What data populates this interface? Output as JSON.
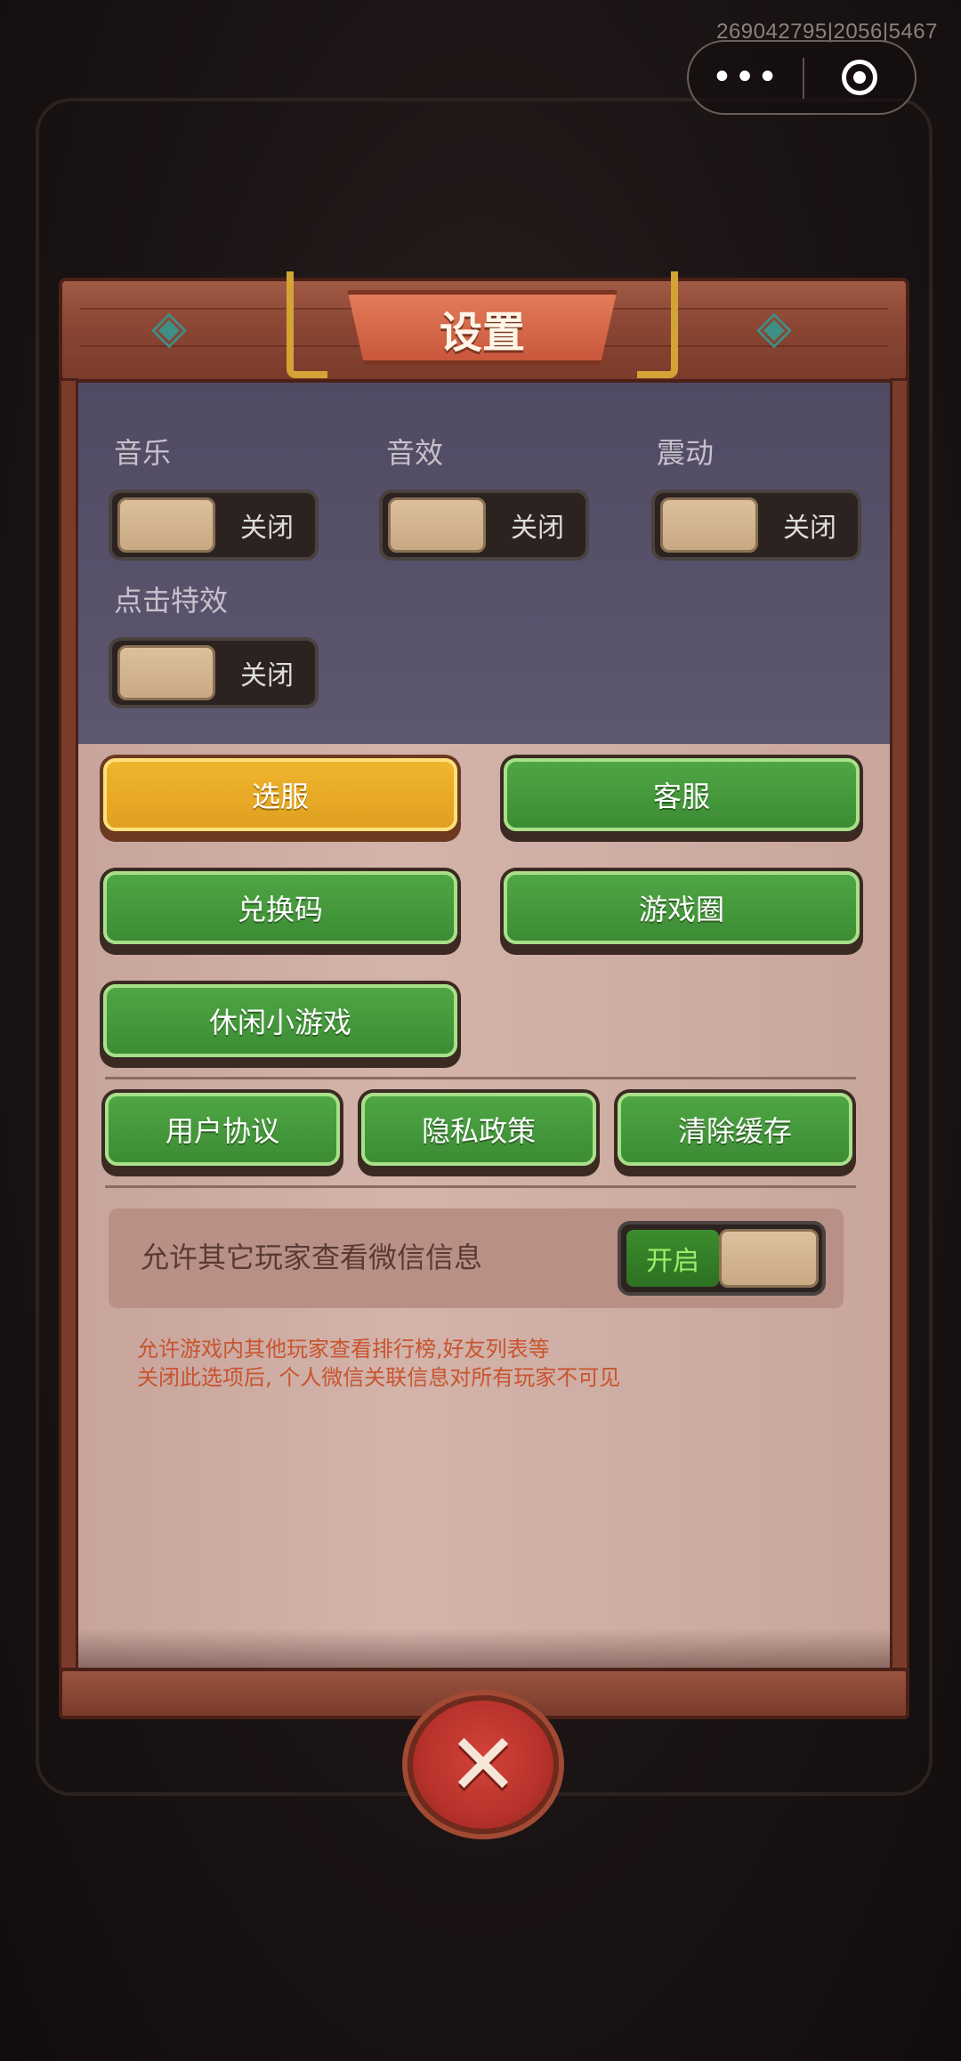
{
  "build_id": "269042795|2056|5467",
  "capsule": {
    "menu_icon": "•••",
    "target_icon": "target-circle"
  },
  "title": "设置",
  "settings": [
    {
      "label": "音乐",
      "state": "关闭"
    },
    {
      "label": "音效",
      "state": "关闭"
    },
    {
      "label": "震动",
      "state": "关闭"
    },
    {
      "label": "点击特效",
      "state": "关闭"
    }
  ],
  "buttons": {
    "select_server": "选服",
    "customer_service": "客服",
    "redeem_code": "兑换码",
    "game_circle": "游戏圈",
    "casual_games": "休闲小游戏",
    "user_agreement": "用户协议",
    "privacy_policy": "隐私政策",
    "clear_cache": "清除缓存"
  },
  "permission": {
    "label": "允许其它玩家查看微信信息",
    "state": "开启",
    "desc_line1": "允许游戏内其他玩家查看排行榜,好友列表等",
    "desc_line2": "关闭此选项后, 个人微信关联信息对所有玩家不可见"
  },
  "close": "✕",
  "colors": {
    "gold": "#E8AA25",
    "green": "#45983B",
    "toggle_on": "#3C8C2E",
    "desc_red": "#C8542E"
  }
}
